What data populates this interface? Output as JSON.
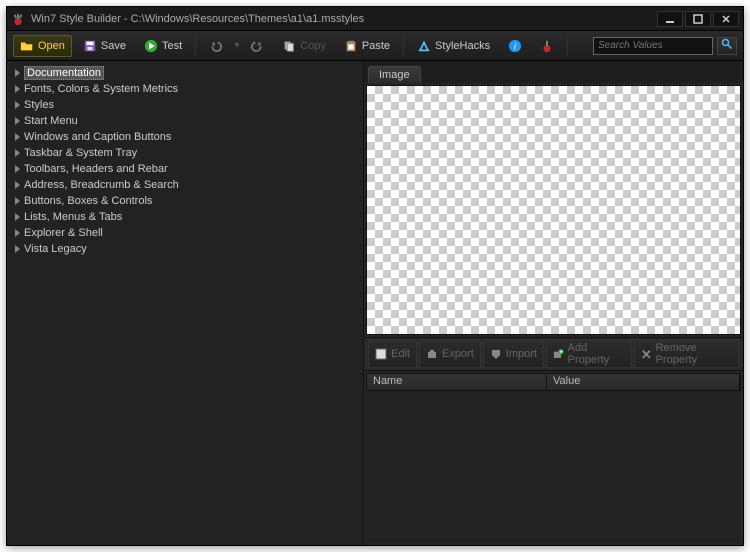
{
  "window": {
    "title": "Win7 Style Builder - C:\\Windows\\Resources\\Themes\\a1\\a1.msstyles"
  },
  "toolbar": {
    "open": "Open",
    "save": "Save",
    "test": "Test",
    "copy": "Copy",
    "paste": "Paste",
    "stylehacks": "StyleHacks",
    "search_placeholder": "Search Values"
  },
  "tree": {
    "items": [
      "Documentation",
      "Fonts, Colors & System Metrics",
      "Styles",
      "Start Menu",
      "Windows and Caption Buttons",
      "Taskbar & System Tray",
      "Toolbars, Headers and Rebar",
      "Address, Breadcrumb & Search",
      "Buttons, Boxes & Controls",
      "Lists, Menus & Tabs",
      "Explorer & Shell",
      "Vista Legacy"
    ],
    "selected_index": 0
  },
  "right": {
    "tab": "Image",
    "actions": {
      "edit": "Edit",
      "export": "Export",
      "import": "Import",
      "add": "Add Property",
      "remove": "Remove Property"
    },
    "columns": {
      "name": "Name",
      "value": "Value"
    }
  }
}
